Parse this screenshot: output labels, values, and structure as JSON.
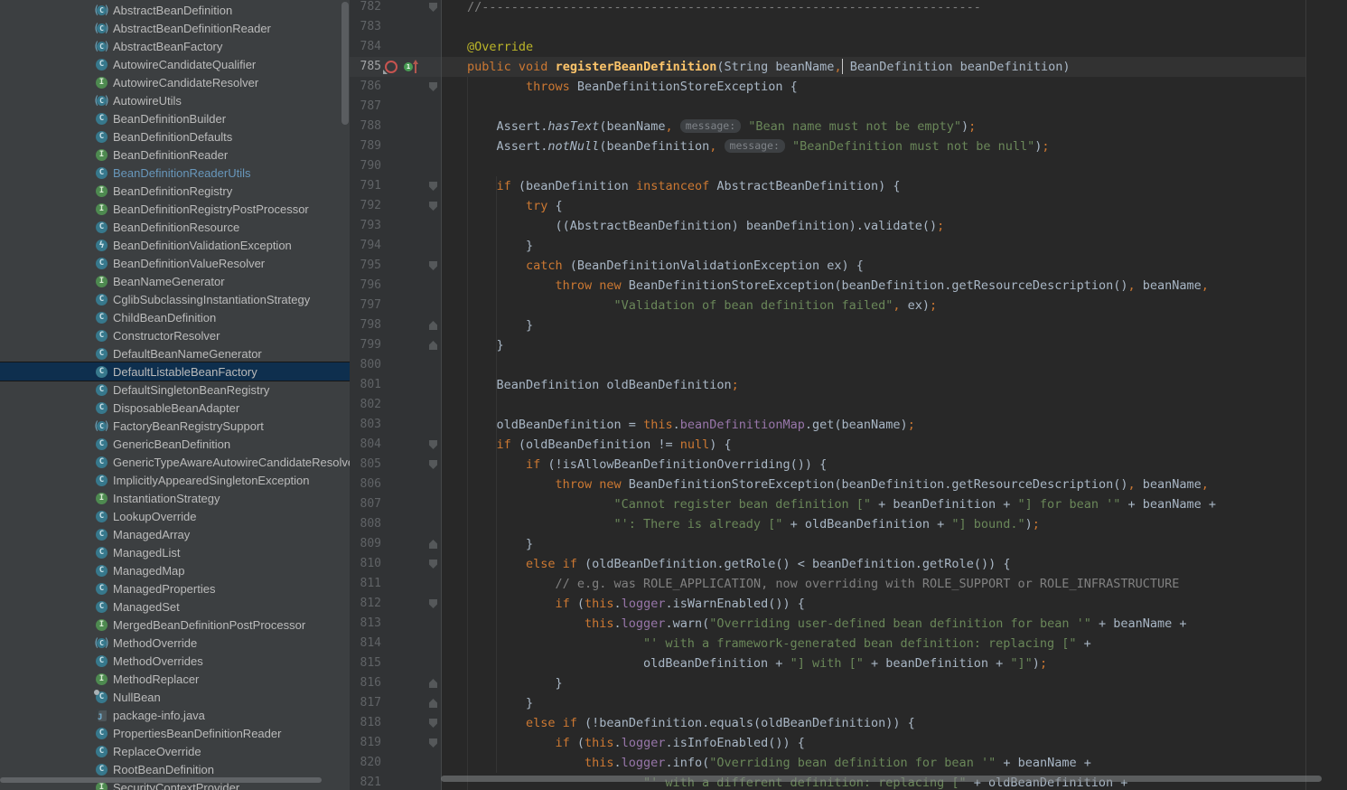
{
  "colors": {
    "editor_bg": "#282828",
    "gutter_bg": "#313335",
    "sidebar_bg": "#3c3f41",
    "selection_bg": "#0e2f4e",
    "keyword": "#cc7832",
    "string": "#6a8759",
    "comment": "#808080",
    "annotation": "#bbb529",
    "field": "#9876aa",
    "plain_text": "#a9b7c6",
    "line_number": "#606366",
    "current_line": "#323232",
    "modified_file": "#6897bb",
    "class_icon": "#37788c",
    "interface_icon": "#4e8a50",
    "scrollbar_thumb": "#5a5d60",
    "hint_bg": "#3d4043"
  },
  "sidebar": {
    "items": [
      {
        "label": "AbstractBeanDefinition",
        "icon": "abstract"
      },
      {
        "label": "AbstractBeanDefinitionReader",
        "icon": "abstract"
      },
      {
        "label": "AbstractBeanFactory",
        "icon": "abstract"
      },
      {
        "label": "AutowireCandidateQualifier",
        "icon": "class"
      },
      {
        "label": "AutowireCandidateResolver",
        "icon": "interface"
      },
      {
        "label": "AutowireUtils",
        "icon": "abstract"
      },
      {
        "label": "BeanDefinitionBuilder",
        "icon": "class"
      },
      {
        "label": "BeanDefinitionDefaults",
        "icon": "class"
      },
      {
        "label": "BeanDefinitionReader",
        "icon": "interface"
      },
      {
        "label": "BeanDefinitionReaderUtils",
        "icon": "class",
        "modified": true
      },
      {
        "label": "BeanDefinitionRegistry",
        "icon": "interface"
      },
      {
        "label": "BeanDefinitionRegistryPostProcessor",
        "icon": "interface"
      },
      {
        "label": "BeanDefinitionResource",
        "icon": "class"
      },
      {
        "label": "BeanDefinitionValidationException",
        "icon": "exception"
      },
      {
        "label": "BeanDefinitionValueResolver",
        "icon": "class"
      },
      {
        "label": "BeanNameGenerator",
        "icon": "interface"
      },
      {
        "label": "CglibSubclassingInstantiationStrategy",
        "icon": "class"
      },
      {
        "label": "ChildBeanDefinition",
        "icon": "class"
      },
      {
        "label": "ConstructorResolver",
        "icon": "class"
      },
      {
        "label": "DefaultBeanNameGenerator",
        "icon": "class"
      },
      {
        "label": "DefaultListableBeanFactory",
        "icon": "class",
        "selected": true
      },
      {
        "label": "DefaultSingletonBeanRegistry",
        "icon": "class"
      },
      {
        "label": "DisposableBeanAdapter",
        "icon": "class"
      },
      {
        "label": "FactoryBeanRegistrySupport",
        "icon": "abstract"
      },
      {
        "label": "GenericBeanDefinition",
        "icon": "class"
      },
      {
        "label": "GenericTypeAwareAutowireCandidateResolver",
        "icon": "class"
      },
      {
        "label": "ImplicitlyAppearedSingletonException",
        "icon": "class"
      },
      {
        "label": "InstantiationStrategy",
        "icon": "interface"
      },
      {
        "label": "LookupOverride",
        "icon": "class"
      },
      {
        "label": "ManagedArray",
        "icon": "class"
      },
      {
        "label": "ManagedList",
        "icon": "class"
      },
      {
        "label": "ManagedMap",
        "icon": "class"
      },
      {
        "label": "ManagedProperties",
        "icon": "class"
      },
      {
        "label": "ManagedSet",
        "icon": "class"
      },
      {
        "label": "MergedBeanDefinitionPostProcessor",
        "icon": "interface"
      },
      {
        "label": "MethodOverride",
        "icon": "abstract"
      },
      {
        "label": "MethodOverrides",
        "icon": "class"
      },
      {
        "label": "MethodReplacer",
        "icon": "interface"
      },
      {
        "label": "NullBean",
        "icon": "class-final"
      },
      {
        "label": "package-info.java",
        "icon": "package"
      },
      {
        "label": "PropertiesBeanDefinitionReader",
        "icon": "class"
      },
      {
        "label": "ReplaceOverride",
        "icon": "class"
      },
      {
        "label": "RootBeanDefinition",
        "icon": "class"
      },
      {
        "label": "SecurityContextProvider",
        "icon": "interface",
        "partial": true
      }
    ]
  },
  "editor": {
    "lines": [
      {
        "n": 782,
        "indent": 0,
        "fold": "d",
        "tokens": [
          [
            "c",
            "//--------------------------------------------------------------------"
          ]
        ]
      },
      {
        "n": 783,
        "indent": 0,
        "tokens": []
      },
      {
        "n": 784,
        "indent": 0,
        "tokens": [
          [
            "a",
            "@Override"
          ]
        ]
      },
      {
        "n": 785,
        "indent": 0,
        "current": true,
        "icons": true,
        "tokens": [
          [
            "k",
            "public"
          ],
          [
            "p",
            " "
          ],
          [
            "k",
            "void"
          ],
          [
            "p",
            " "
          ],
          [
            "m",
            "registerBeanDefinition"
          ],
          [
            "p",
            "(String beanName"
          ],
          [
            "o",
            ","
          ],
          [
            "caret",
            ""
          ],
          [
            "p",
            " BeanDefinition beanDefinition)"
          ]
        ]
      },
      {
        "n": 786,
        "indent": 2,
        "fold": "d",
        "tokens": [
          [
            "k",
            "throws"
          ],
          [
            "p",
            " BeanDefinitionStoreException {"
          ]
        ]
      },
      {
        "n": 787,
        "indent": 0,
        "tokens": []
      },
      {
        "n": 788,
        "indent": 1,
        "tokens": [
          [
            "p",
            "Assert."
          ],
          [
            "i",
            "hasText"
          ],
          [
            "p",
            "(beanName"
          ],
          [
            "o",
            ","
          ],
          [
            "p",
            " "
          ],
          [
            "h",
            "message:"
          ],
          [
            "p",
            " "
          ],
          [
            "s",
            "\"Bean name must not be empty\""
          ],
          [
            "p",
            ")"
          ],
          [
            "o",
            ";"
          ]
        ]
      },
      {
        "n": 789,
        "indent": 1,
        "tokens": [
          [
            "p",
            "Assert."
          ],
          [
            "i",
            "notNull"
          ],
          [
            "p",
            "(beanDefinition"
          ],
          [
            "o",
            ","
          ],
          [
            "p",
            " "
          ],
          [
            "h",
            "message:"
          ],
          [
            "p",
            " "
          ],
          [
            "s",
            "\"BeanDefinition must not be null\""
          ],
          [
            "p",
            ")"
          ],
          [
            "o",
            ";"
          ]
        ]
      },
      {
        "n": 790,
        "indent": 0,
        "tokens": []
      },
      {
        "n": 791,
        "indent": 1,
        "fold": "d",
        "tokens": [
          [
            "k",
            "if"
          ],
          [
            "p",
            " (beanDefinition "
          ],
          [
            "k",
            "instanceof"
          ],
          [
            "p",
            " AbstractBeanDefinition) {"
          ]
        ]
      },
      {
        "n": 792,
        "indent": 2,
        "fold": "d",
        "tokens": [
          [
            "k",
            "try"
          ],
          [
            "p",
            " {"
          ]
        ]
      },
      {
        "n": 793,
        "indent": 3,
        "tokens": [
          [
            "p",
            "((AbstractBeanDefinition) beanDefinition).validate()"
          ],
          [
            "o",
            ";"
          ]
        ]
      },
      {
        "n": 794,
        "indent": 2,
        "tokens": [
          [
            "p",
            "}"
          ]
        ]
      },
      {
        "n": 795,
        "indent": 2,
        "fold": "d",
        "tokens": [
          [
            "k",
            "catch"
          ],
          [
            "p",
            " (BeanDefinitionValidationException ex) {"
          ]
        ]
      },
      {
        "n": 796,
        "indent": 3,
        "tokens": [
          [
            "k",
            "throw"
          ],
          [
            "p",
            " "
          ],
          [
            "k",
            "new"
          ],
          [
            "p",
            " BeanDefinitionStoreException(beanDefinition.getResourceDescription()"
          ],
          [
            "o",
            ","
          ],
          [
            "p",
            " beanName"
          ],
          [
            "o",
            ","
          ]
        ]
      },
      {
        "n": 797,
        "indent": 5,
        "tokens": [
          [
            "s",
            "\"Validation of bean definition failed\""
          ],
          [
            "o",
            ","
          ],
          [
            "p",
            " ex)"
          ],
          [
            "o",
            ";"
          ]
        ]
      },
      {
        "n": 798,
        "indent": 2,
        "fold": "u",
        "tokens": [
          [
            "p",
            "}"
          ]
        ]
      },
      {
        "n": 799,
        "indent": 1,
        "fold": "u",
        "tokens": [
          [
            "p",
            "}"
          ]
        ]
      },
      {
        "n": 800,
        "indent": 0,
        "tokens": []
      },
      {
        "n": 801,
        "indent": 1,
        "tokens": [
          [
            "p",
            "BeanDefinition oldBeanDefinition"
          ],
          [
            "o",
            ";"
          ]
        ]
      },
      {
        "n": 802,
        "indent": 0,
        "tokens": []
      },
      {
        "n": 803,
        "indent": 1,
        "tokens": [
          [
            "p",
            "oldBeanDefinition = "
          ],
          [
            "k",
            "this"
          ],
          [
            "p",
            "."
          ],
          [
            "f",
            "beanDefinitionMap"
          ],
          [
            "p",
            ".get(beanName)"
          ],
          [
            "o",
            ";"
          ]
        ]
      },
      {
        "n": 804,
        "indent": 1,
        "fold": "d",
        "tokens": [
          [
            "k",
            "if"
          ],
          [
            "p",
            " (oldBeanDefinition != "
          ],
          [
            "k",
            "null"
          ],
          [
            "p",
            ") {"
          ]
        ]
      },
      {
        "n": 805,
        "indent": 2,
        "fold": "d",
        "tokens": [
          [
            "k",
            "if"
          ],
          [
            "p",
            " (!isAllowBeanDefinitionOverriding()) {"
          ]
        ]
      },
      {
        "n": 806,
        "indent": 3,
        "tokens": [
          [
            "k",
            "throw"
          ],
          [
            "p",
            " "
          ],
          [
            "k",
            "new"
          ],
          [
            "p",
            " BeanDefinitionStoreException(beanDefinition.getResourceDescription()"
          ],
          [
            "o",
            ","
          ],
          [
            "p",
            " beanName"
          ],
          [
            "o",
            ","
          ]
        ]
      },
      {
        "n": 807,
        "indent": 5,
        "tokens": [
          [
            "s",
            "\"Cannot register bean definition [\""
          ],
          [
            "p",
            " + beanDefinition + "
          ],
          [
            "s",
            "\"] for bean '\""
          ],
          [
            "p",
            " + beanName +"
          ]
        ]
      },
      {
        "n": 808,
        "indent": 5,
        "tokens": [
          [
            "s",
            "\"': There is already [\""
          ],
          [
            "p",
            " + oldBeanDefinition + "
          ],
          [
            "s",
            "\"] bound.\""
          ],
          [
            "p",
            ")"
          ],
          [
            "o",
            ";"
          ]
        ]
      },
      {
        "n": 809,
        "indent": 2,
        "fold": "u",
        "tokens": [
          [
            "p",
            "}"
          ]
        ]
      },
      {
        "n": 810,
        "indent": 2,
        "fold": "d",
        "tokens": [
          [
            "k",
            "else"
          ],
          [
            "p",
            " "
          ],
          [
            "k",
            "if"
          ],
          [
            "p",
            " (oldBeanDefinition.getRole() < beanDefinition.getRole()) {"
          ]
        ]
      },
      {
        "n": 811,
        "indent": 3,
        "tokens": [
          [
            "c",
            "// e.g. was ROLE_APPLICATION, now overriding with ROLE_SUPPORT or ROLE_INFRASTRUCTURE"
          ]
        ]
      },
      {
        "n": 812,
        "indent": 3,
        "fold": "d",
        "tokens": [
          [
            "k",
            "if"
          ],
          [
            "p",
            " ("
          ],
          [
            "k",
            "this"
          ],
          [
            "p",
            "."
          ],
          [
            "f",
            "logger"
          ],
          [
            "p",
            ".isWarnEnabled()) {"
          ]
        ]
      },
      {
        "n": 813,
        "indent": 4,
        "tokens": [
          [
            "k",
            "this"
          ],
          [
            "p",
            "."
          ],
          [
            "f",
            "logger"
          ],
          [
            "p",
            ".warn("
          ],
          [
            "s",
            "\"Overriding user-defined bean definition for bean '\""
          ],
          [
            "p",
            " + beanName +"
          ]
        ]
      },
      {
        "n": 814,
        "indent": 6,
        "tokens": [
          [
            "s",
            "\"' with a framework-generated bean definition: replacing [\""
          ],
          [
            "p",
            " +"
          ]
        ]
      },
      {
        "n": 815,
        "indent": 6,
        "tokens": [
          [
            "p",
            "oldBeanDefinition + "
          ],
          [
            "s",
            "\"] with [\""
          ],
          [
            "p",
            " + beanDefinition + "
          ],
          [
            "s",
            "\"]\""
          ],
          [
            "p",
            ")"
          ],
          [
            "o",
            ";"
          ]
        ]
      },
      {
        "n": 816,
        "indent": 3,
        "fold": "u",
        "tokens": [
          [
            "p",
            "}"
          ]
        ]
      },
      {
        "n": 817,
        "indent": 2,
        "fold": "u",
        "tokens": [
          [
            "p",
            "}"
          ]
        ]
      },
      {
        "n": 818,
        "indent": 2,
        "fold": "d",
        "tokens": [
          [
            "k",
            "else"
          ],
          [
            "p",
            " "
          ],
          [
            "k",
            "if"
          ],
          [
            "p",
            " (!beanDefinition.equals(oldBeanDefinition)) {"
          ]
        ]
      },
      {
        "n": 819,
        "indent": 3,
        "fold": "d",
        "tokens": [
          [
            "k",
            "if"
          ],
          [
            "p",
            " ("
          ],
          [
            "k",
            "this"
          ],
          [
            "p",
            "."
          ],
          [
            "f",
            "logger"
          ],
          [
            "p",
            ".isInfoEnabled()) {"
          ]
        ]
      },
      {
        "n": 820,
        "indent": 4,
        "tokens": [
          [
            "k",
            "this"
          ],
          [
            "p",
            "."
          ],
          [
            "f",
            "logger"
          ],
          [
            "p",
            ".info("
          ],
          [
            "s",
            "\"Overriding bean definition for bean '\""
          ],
          [
            "p",
            " + beanName +"
          ]
        ]
      },
      {
        "n": 821,
        "indent": 6,
        "tokens": [
          [
            "s",
            "\"' with a different definition: replacing [\""
          ],
          [
            "p",
            " + oldBeanDefinition +"
          ]
        ]
      }
    ],
    "gutter_icon_override_glyph": "1"
  }
}
